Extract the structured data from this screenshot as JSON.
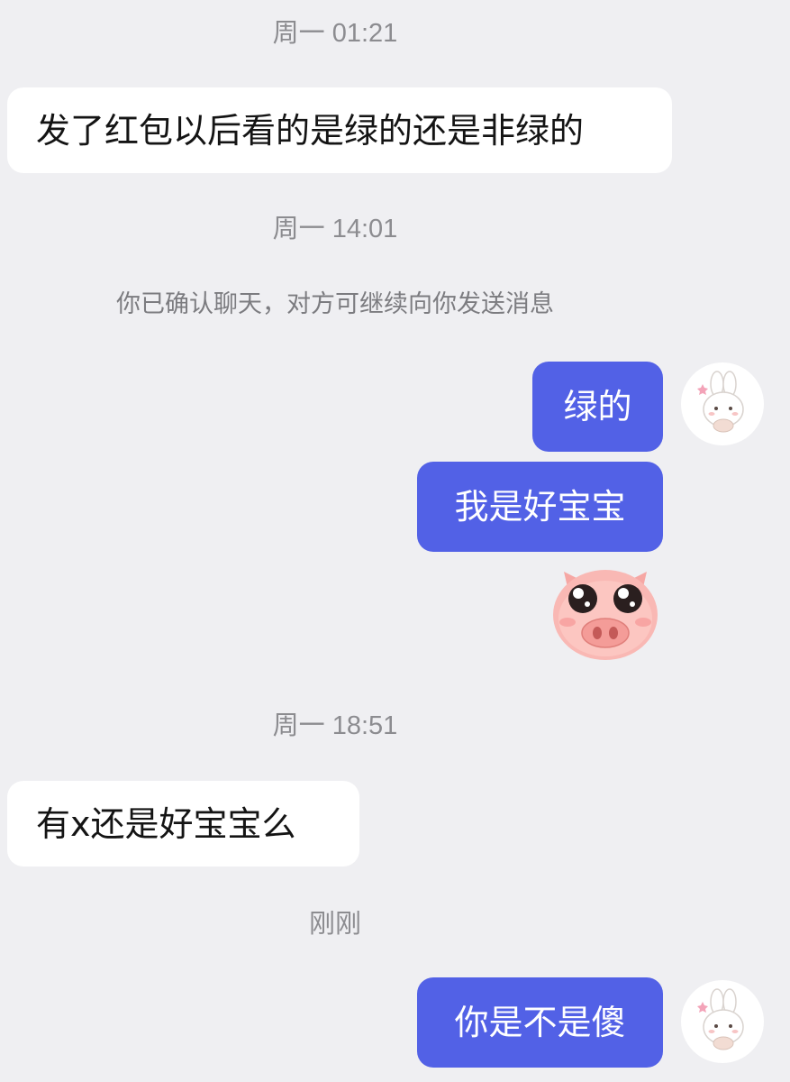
{
  "chat": {
    "timestamps": {
      "t1": "周一 01:21",
      "t2": "周一 14:01",
      "t3": "周一 18:51",
      "t4": "刚刚"
    },
    "system_notice": "你已确认聊天，对方可继续向你发送消息",
    "messages": {
      "m1": "发了红包以后看的是绿的还是非绿的",
      "m2": "绿的",
      "m3": "我是好宝宝",
      "m5": "有x还是好宝宝么",
      "m6": "你是不是傻"
    },
    "sticker": "pig-face-sticker",
    "avatar_icon": "bunny-avatar-icon",
    "colors": {
      "background": "#efeff2",
      "incoming_bubble": "#ffffff",
      "outgoing_bubble": "#5261e6",
      "timestamp_text": "#8c8c90"
    }
  }
}
